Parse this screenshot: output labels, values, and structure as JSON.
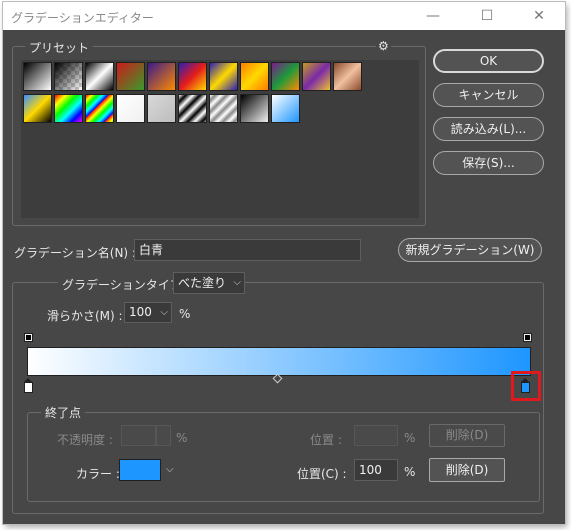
{
  "window": {
    "title": "グラデーションエディター",
    "minimize_icon": "—",
    "maximize_icon": "☐",
    "close_icon": "✕"
  },
  "presets": {
    "label": "プリセット",
    "gear_icon": "⚙",
    "swatches_row1": [
      "linear-gradient(135deg,#000 0%,#fff 100%)",
      "linear-gradient(135deg,#000 0%,rgba(0,0,0,0) 100%)",
      "linear-gradient(135deg,#000 0%,#fff 50%,#000 100%)",
      "linear-gradient(135deg,#cc1b1b 0%,#3a9a2a 100%)",
      "linear-gradient(135deg,#3b1a8a 0%,#ff8a00 100%)",
      "linear-gradient(135deg,#2a1fb5 0%,#e41b1b 50%,#ffd900 100%)",
      "linear-gradient(135deg,#2a1fb5 0%,#ffd900 50%,#2a1fb5 100%)",
      "linear-gradient(135deg,#ff7d00 0%,#ffd900 50%,#ff7d00 100%)",
      "linear-gradient(135deg,#7a1a8a 0%,#1e9a3a 50%,#ff8a00 100%)",
      "linear-gradient(135deg,#c49a22 0%,#7a2aa8 50%,#f0c030 100%)",
      "linear-gradient(135deg,#8a4a2a 0%,#f0c0a0 50%,#8a4a2a 100%)"
    ],
    "swatches_row2": [
      "linear-gradient(135deg,#3a8fff 0%,#ffd900 50%,#000 100%)",
      "linear-gradient(135deg,#ff0000,#ffff00,#00ff00,#00ffff,#0000ff,#ff00ff)",
      "repeating-linear-gradient(135deg,#ff0000 0px,#ffff00 4px,#00ff00 8px,#00ffff 12px,#0000ff 16px)",
      "linear-gradient(135deg,#ffffff,#f0f0f0)",
      "linear-gradient(135deg,#d8d8d8,#bdbdbd)",
      "repeating-linear-gradient(135deg,#ffffff 0px,#000000 5px,#ffffff 10px)",
      "repeating-linear-gradient(135deg,#ffffff 0px,#888888 4px,#ffffff 8px)",
      "linear-gradient(135deg,#000 0%,#f0f0f0 100%)",
      "linear-gradient(135deg,#ffffff 0%,#1e96ff 100%)"
    ]
  },
  "buttons": {
    "ok": "OK",
    "cancel": "キャンセル",
    "load": "読み込み(L)...",
    "save": "保存(S)...",
    "new_gradient": "新規グラデーション(W)"
  },
  "gradient_name": {
    "label": "グラデーション名(N) :",
    "value": "白青"
  },
  "gradient_type": {
    "label": "グラデーションタイプ :",
    "value": "べた塗り"
  },
  "smoothness": {
    "label": "滑らかさ(M) :",
    "value": "100",
    "unit": "%"
  },
  "gradient_bar": {
    "from": "#ffffff",
    "to": "#1e96ff"
  },
  "stops": {
    "label": "終了点",
    "opacity_label": "不透明度 :",
    "opacity_value": "",
    "opacity_unit": "%",
    "opacity_position_label": "位置 :",
    "opacity_position_value": "",
    "opacity_position_unit": "%",
    "opacity_delete": "削除(D)",
    "color_label": "カラー :",
    "color_value": "#1e96ff",
    "color_position_label": "位置(C) :",
    "color_position_value": "100",
    "color_position_unit": "%",
    "color_delete": "削除(D)"
  },
  "highlight_color": "#e0191e"
}
